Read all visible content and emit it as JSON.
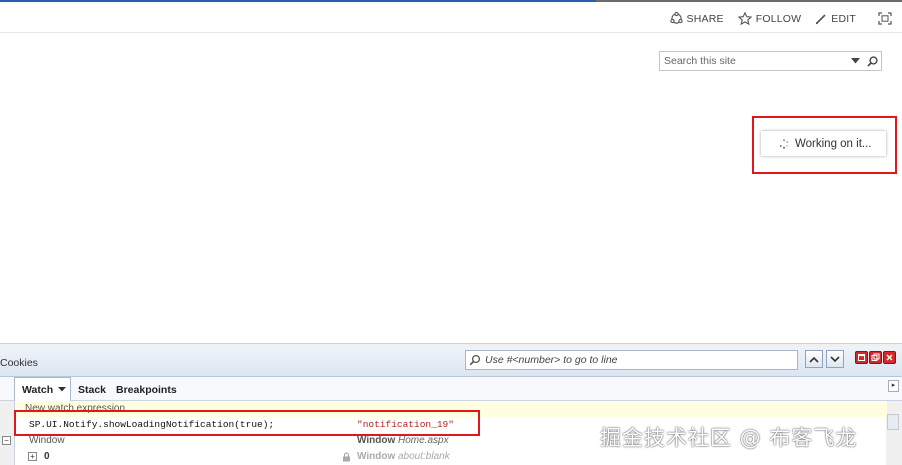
{
  "toolbar": {
    "share_label": "SHARE",
    "follow_label": "FOLLOW",
    "edit_label": "EDIT"
  },
  "search": {
    "placeholder": "Search this site"
  },
  "notification": {
    "text": "Working on it..."
  },
  "devtools": {
    "panel_title": "Cookies",
    "goto_placeholder": "Use #<number> to go to line",
    "tabs": [
      {
        "label": "Watch",
        "active": true
      },
      {
        "label": "Stack",
        "active": false
      },
      {
        "label": "Breakpoints",
        "active": false
      }
    ],
    "new_watch_placeholder": "New watch expression...",
    "watch_rows": [
      {
        "name": "SP.UI.Notify.showLoadingNotification(true);",
        "value": "\"notification_19\""
      },
      {
        "name": "Window",
        "type": "Window",
        "value": "Home.aspx"
      },
      {
        "name": "0",
        "type": "Window",
        "value": "about:blank"
      }
    ]
  },
  "watermark": {
    "text": "掘金技术社区 @ 布客飞龙"
  }
}
